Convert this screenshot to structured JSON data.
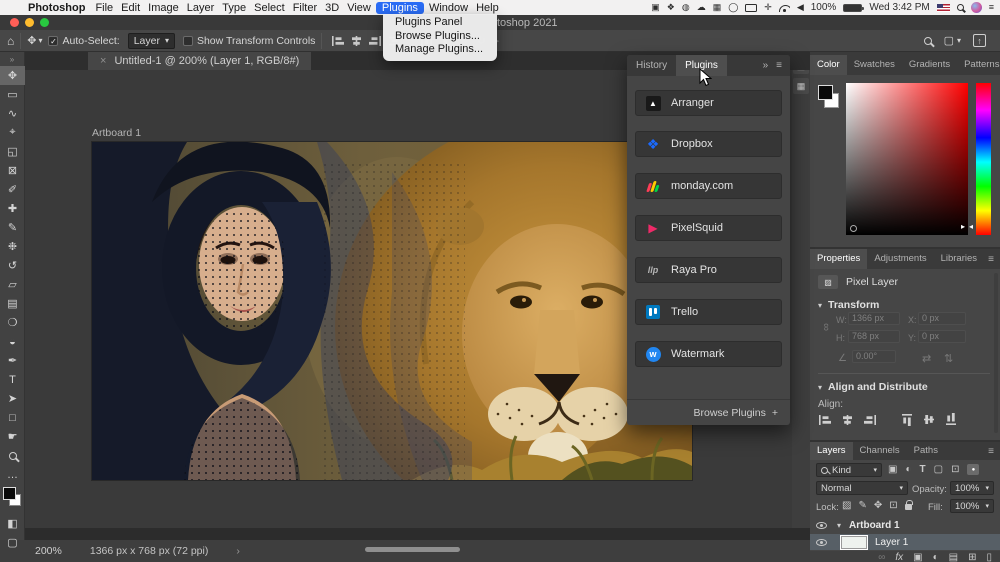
{
  "menu_bar": {
    "apple": "",
    "app_name": "Photoshop",
    "items": [
      "File",
      "Edit",
      "Image",
      "Layer",
      "Type",
      "Select",
      "Filter",
      "3D",
      "View",
      "Plugins",
      "Window",
      "Help"
    ],
    "active_item": "Plugins",
    "menu_icons": [
      "▣",
      "❖",
      "◍",
      "☁",
      "▦",
      "◯",
      "▢",
      "✛"
    ],
    "battery_pct": "100%",
    "clock": "Wed 3:42 PM"
  },
  "plugins_menu": [
    "Plugins Panel",
    "Browse Plugins...",
    "Manage Plugins..."
  ],
  "window": {
    "title_partial": "toshop 2021"
  },
  "options_bar": {
    "auto_select_label": "Auto-Select:",
    "auto_select_value": "Layer",
    "show_transform_label": "Show Transform Controls"
  },
  "document_tab": {
    "close": "×",
    "title": "Untitled-1 @ 200% (Layer 1, RGB/8#)"
  },
  "tools": [
    {
      "name": "move",
      "glyph": "✥"
    },
    {
      "name": "rectangular-marquee",
      "glyph": "▭"
    },
    {
      "name": "lasso",
      "glyph": "∿"
    },
    {
      "name": "object-selection",
      "glyph": "⌖"
    },
    {
      "name": "crop",
      "glyph": "◱"
    },
    {
      "name": "frame",
      "glyph": "⊠"
    },
    {
      "name": "eyedropper",
      "glyph": "✐"
    },
    {
      "name": "healing-brush",
      "glyph": "✚"
    },
    {
      "name": "brush",
      "glyph": "✎"
    },
    {
      "name": "clone-stamp",
      "glyph": "❉"
    },
    {
      "name": "history-brush",
      "glyph": "↺"
    },
    {
      "name": "eraser",
      "glyph": "▱"
    },
    {
      "name": "gradient",
      "glyph": "▤"
    },
    {
      "name": "blur",
      "glyph": "❍"
    },
    {
      "name": "dodge",
      "glyph": "◒"
    },
    {
      "name": "pen",
      "glyph": "✒"
    },
    {
      "name": "type",
      "glyph": "T"
    },
    {
      "name": "path-selection",
      "glyph": "➤"
    },
    {
      "name": "rectangle",
      "glyph": "□"
    },
    {
      "name": "hand",
      "glyph": "☛"
    },
    {
      "name": "zoom",
      "glyph": ""
    },
    {
      "name": "edit-toolbar",
      "glyph": "…"
    }
  ],
  "canvas": {
    "artboard_label": "Artboard 1"
  },
  "plugins_panel": {
    "tabs": [
      "History",
      "Plugins"
    ],
    "active_tab": "Plugins",
    "items": [
      "Arranger",
      "Dropbox",
      "monday.com",
      "PixelSquid",
      "Raya Pro",
      "Trello",
      "Watermark"
    ],
    "raya_logo": "llp",
    "watermark_letter": "w",
    "arranger_glyph": "▲",
    "pixelsquid_glyph": "▶",
    "footer": "Browse Plugins",
    "footer_plus": "+"
  },
  "color_panel": {
    "tabs": [
      "Color",
      "Swatches",
      "Gradients",
      "Patterns"
    ],
    "active_tab": "Color"
  },
  "properties_panel": {
    "tabs": [
      "Properties",
      "Adjustments",
      "Libraries"
    ],
    "active_tab": "Properties",
    "layer_type": "Pixel Layer",
    "transform_section": "Transform",
    "w_label": "W:",
    "w_value": "1366 px",
    "x_label": "X:",
    "x_value": "0 px",
    "h_label": "H:",
    "h_value": "768 px",
    "y_label": "Y:",
    "y_value": "0 px",
    "angle_value": "0.00°",
    "align_section": "Align and Distribute",
    "align_label": "Align:"
  },
  "layers_panel": {
    "tabs": [
      "Layers",
      "Channels",
      "Paths"
    ],
    "active_tab": "Layers",
    "kind_filter": "Kind",
    "blend_mode": "Normal",
    "opacity_label": "Opacity:",
    "opacity_value": "100%",
    "lock_label": "Lock:",
    "fill_label": "Fill:",
    "fill_value": "100%",
    "artboard_name": "Artboard 1",
    "layer_name": "Layer 1",
    "fx_label": "fx"
  },
  "status_bar": {
    "zoom_level": "200%",
    "doc_info": "1366 px x 768 px (72 ppi)",
    "chevron": "›"
  },
  "icons": {
    "home": "⌂",
    "move": "✥",
    "chevron_down": "▾",
    "check": "✓",
    "collapse": "»",
    "panel_menu": "≡",
    "close": "×",
    "t3d1": "✥",
    "t3d2": "↻",
    "t3d3": "▸",
    "share_arrow": "↑",
    "link": "∞",
    "angle": "∠",
    "flip_h": "⇄",
    "flip_v": "⇅",
    "filter_pixel": "▣",
    "filter_adjust": "◐",
    "filter_type": "T",
    "filter_shape": "▢",
    "filter_smart": "⊡",
    "lock_transparent": "▨",
    "lock_paint": "✎",
    "lock_position": "✥",
    "lock_artboard": "⊡",
    "fx_mask": "▣",
    "fx_adjust": "◐",
    "folder": "▤",
    "new_layer": "⊞",
    "trash": "▯",
    "dock1": "▤",
    "dock2": "▦",
    "pixel_layer_thumb": "▨",
    "tri_left": "◂",
    "tri_right": "▸",
    "volume": "◀",
    "mask_mode": "◧",
    "screen_mode": "▢"
  }
}
